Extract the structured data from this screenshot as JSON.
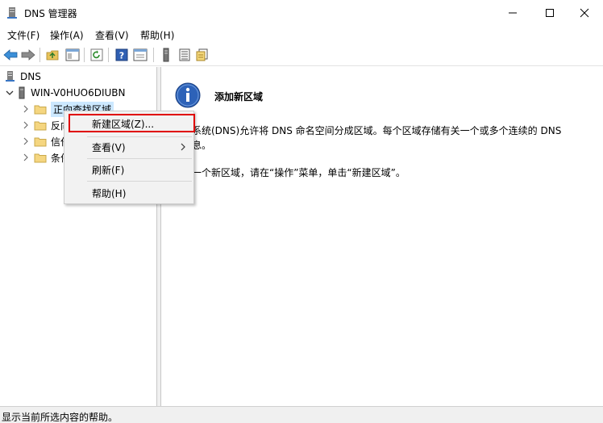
{
  "window": {
    "title": "DNS 管理器",
    "icon": "dns-server-icon"
  },
  "menu": {
    "items": [
      "文件(F)",
      "操作(A)",
      "查看(V)",
      "帮助(H)"
    ]
  },
  "toolbar": {
    "icons": [
      "back-arrow-icon",
      "forward-arrow-icon",
      "up-folder-icon",
      "show-hide-console-tree-icon",
      "refresh-icon",
      "help-icon",
      "properties-icon",
      "server-icon",
      "list-icon",
      "export-icon"
    ]
  },
  "tree": {
    "root": "DNS",
    "server": "WIN-V0HUO6DIUBN",
    "nodes": [
      "正向查找区域",
      "反向查找区域",
      "信任点",
      "条件转发器"
    ],
    "nodes_visible": [
      "正向查找区域",
      "反向",
      "信任",
      "条件"
    ]
  },
  "info_panel": {
    "title": "添加新区域",
    "description": "称系统(DNS)允许将 DNS 命名空间分成区域。每个区域存储有关一个或多个连续的 DNS",
    "description_line2": "信息。",
    "instruction": "加一个新区域，请在“操作”菜单，单击“新建区域”。"
  },
  "context_menu": {
    "items": [
      {
        "label": "新建区域(Z)...",
        "highlighted": true
      },
      {
        "label": "查看(V)",
        "submenu": true
      },
      {
        "label": "刷新(F)"
      },
      {
        "label": "帮助(H)"
      }
    ]
  },
  "statusbar": {
    "text": "显示当前所选内容的帮助。"
  },
  "colors": {
    "highlight_border": "#e00000",
    "selection": "#cce8ff",
    "menu_bg": "#f2f2f2"
  }
}
